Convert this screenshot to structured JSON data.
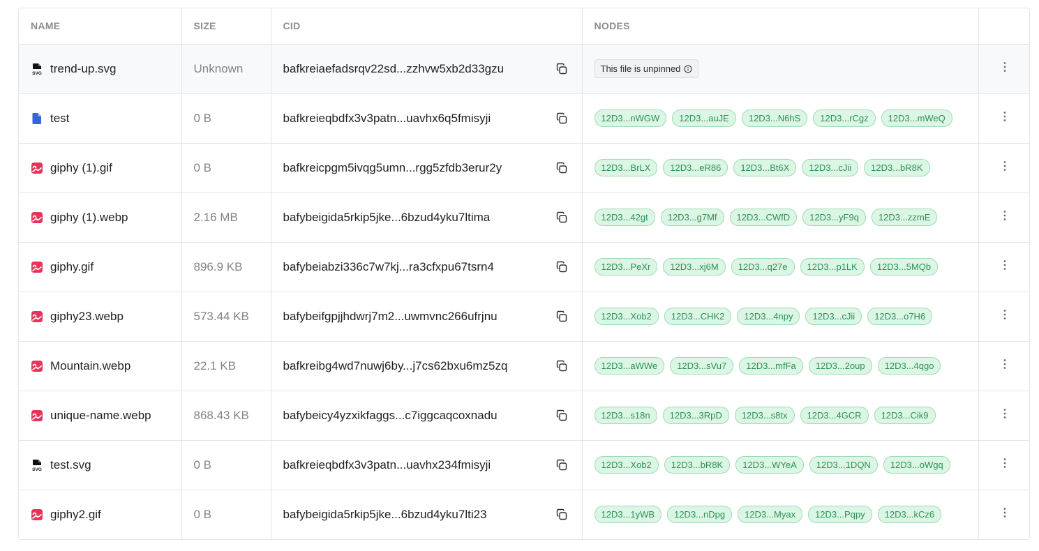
{
  "columns": {
    "name": "NAME",
    "size": "SIZE",
    "cid": "CID",
    "nodes": "NODES"
  },
  "colors": {
    "accent_pill": "#dcf6e5",
    "pill_text": "#2e8f55",
    "image_icon": "#e8345a",
    "doc_icon": "#3b63d6"
  },
  "rows": [
    {
      "name": "trend-up.svg",
      "icon": "svg-file-icon",
      "size": "Unknown",
      "cid": "bafkreiaefadsrqv22sd...zzhvw5xb2d33gzu",
      "unpinned": "This file is unpinned",
      "nodes": []
    },
    {
      "name": "test",
      "icon": "document-icon",
      "size": "0 B",
      "cid": "bafkreieqbdfx3v3patn...uavhx6q5fmisyji",
      "nodes": [
        "12D3...nWGW",
        "12D3...auJE",
        "12D3...N6hS",
        "12D3...rCgz",
        "12D3...mWeQ"
      ]
    },
    {
      "name": "giphy (1).gif",
      "icon": "image-icon",
      "size": "0 B",
      "cid": "bafkreicpgm5ivqg5umn...rgg5zfdb3erur2y",
      "nodes": [
        "12D3...BrLX",
        "12D3...eR86",
        "12D3...Bt6X",
        "12D3...cJii",
        "12D3...bR8K"
      ]
    },
    {
      "name": "giphy (1).webp",
      "icon": "image-icon",
      "size": "2.16 MB",
      "cid": "bafybeigida5rkip5jke...6bzud4yku7ltima",
      "nodes": [
        "12D3...42gt",
        "12D3...g7Mf",
        "12D3...CWfD",
        "12D3...yF9q",
        "12D3...zzmE"
      ]
    },
    {
      "name": "giphy.gif",
      "icon": "image-icon",
      "size": "896.9 KB",
      "cid": "bafybeiabzi336c7w7kj...ra3cfxpu67tsrn4",
      "nodes": [
        "12D3...PeXr",
        "12D3...xj6M",
        "12D3...q27e",
        "12D3...p1LK",
        "12D3...5MQb"
      ]
    },
    {
      "name": "giphy23.webp",
      "icon": "image-icon",
      "size": "573.44 KB",
      "cid": "bafybeifgpjjhdwrj7m2...uwmvnc266ufrjnu",
      "nodes": [
        "12D3...Xob2",
        "12D3...CHK2",
        "12D3...4npy",
        "12D3...cJii",
        "12D3...o7H6"
      ]
    },
    {
      "name": "Mountain.webp",
      "icon": "image-icon",
      "size": "22.1 KB",
      "cid": "bafkreibg4wd7nuwj6by...j7cs62bxu6mz5zq",
      "nodes": [
        "12D3...aWWe",
        "12D3...sVu7",
        "12D3...mfFa",
        "12D3...2oup",
        "12D3...4qgo"
      ]
    },
    {
      "name": "unique-name.webp",
      "icon": "image-icon",
      "size": "868.43 KB",
      "cid": "bafybeicy4yzxikfaggs...c7iggcaqcoxnadu",
      "nodes": [
        "12D3...s18n",
        "12D3...3RpD",
        "12D3...s8tx",
        "12D3...4GCR",
        "12D3...Cik9"
      ]
    },
    {
      "name": "test.svg",
      "icon": "svg-file-icon",
      "size": "0 B",
      "cid": "bafkreieqbdfx3v3patn...uavhx234fmisyji",
      "nodes": [
        "12D3...Xob2",
        "12D3...bR8K",
        "12D3...WYeA",
        "12D3...1DQN",
        "12D3...oWgq"
      ]
    },
    {
      "name": "giphy2.gif",
      "icon": "image-icon",
      "size": "0 B",
      "cid": "bafybeigida5rkip5jke...6bzud4yku7lti23",
      "nodes": [
        "12D3...1yWB",
        "12D3...nDpg",
        "12D3...Myax",
        "12D3...Pqpy",
        "12D3...kCz6"
      ]
    }
  ]
}
